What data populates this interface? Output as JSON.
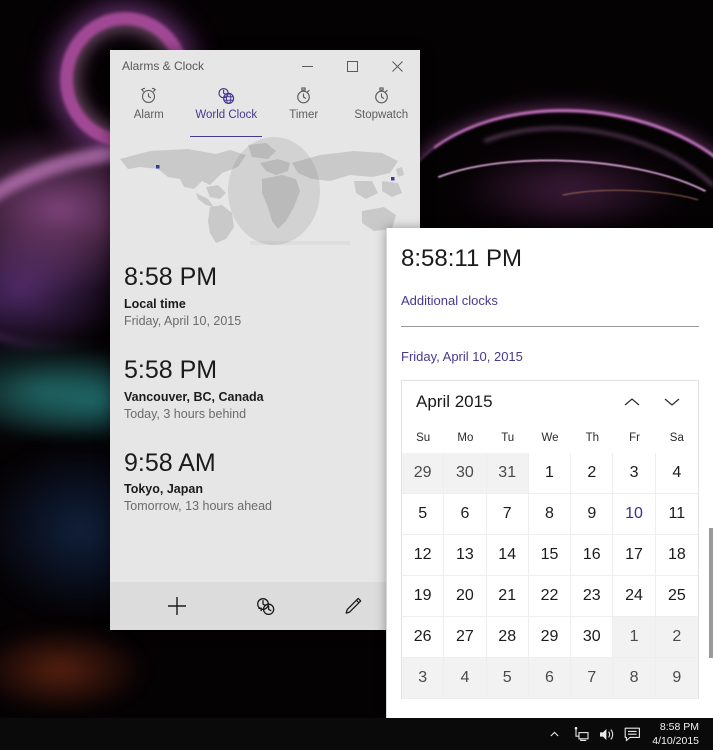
{
  "window": {
    "title": "Alarms & Clock",
    "controls": {
      "minimize": "—",
      "maximize": "☐",
      "close": "✕"
    }
  },
  "tabs": [
    {
      "label": "Alarm",
      "icon": "alarm-clock-icon",
      "active": false
    },
    {
      "label": "World Clock",
      "icon": "world-clock-globe-icon",
      "active": true
    },
    {
      "label": "Timer",
      "icon": "timer-icon",
      "active": false
    },
    {
      "label": "Stopwatch",
      "icon": "stopwatch-icon",
      "active": false
    }
  ],
  "clocks": [
    {
      "time": "8:58 PM",
      "place": "Local time",
      "sub": "Friday, April 10, 2015"
    },
    {
      "time": "5:58 PM",
      "place": "Vancouver, BC, Canada",
      "sub": "Today, 3 hours behind"
    },
    {
      "time": "9:58 AM",
      "place": "Tokyo, Japan",
      "sub": "Tomorrow, 13 hours ahead"
    }
  ],
  "commandbar": [
    {
      "name": "add-clock-button",
      "icon": "plus-icon"
    },
    {
      "name": "compare-clocks-button",
      "icon": "compare-clocks-icon"
    },
    {
      "name": "edit-clocks-button",
      "icon": "pencil-icon"
    }
  ],
  "flyout": {
    "time": "8:58:11 PM",
    "additional_clocks_link": "Additional clocks",
    "date_full": "Friday, April 10, 2015",
    "calendar": {
      "month_label": "April 2015",
      "prev_label": "⌃",
      "next_label": "⌄",
      "day_headers": [
        "Su",
        "Mo",
        "Tu",
        "We",
        "Th",
        "Fr",
        "Sa"
      ],
      "weeks": [
        [
          {
            "d": "29",
            "adjacent": true
          },
          {
            "d": "30",
            "adjacent": true
          },
          {
            "d": "31",
            "adjacent": true
          },
          {
            "d": "1",
            "adjacent": false
          },
          {
            "d": "2",
            "adjacent": false
          },
          {
            "d": "3",
            "adjacent": false
          },
          {
            "d": "4",
            "adjacent": false
          }
        ],
        [
          {
            "d": "5",
            "adjacent": false
          },
          {
            "d": "6",
            "adjacent": false
          },
          {
            "d": "7",
            "adjacent": false
          },
          {
            "d": "8",
            "adjacent": false
          },
          {
            "d": "9",
            "adjacent": false
          },
          {
            "d": "10",
            "adjacent": false,
            "today": true
          },
          {
            "d": "11",
            "adjacent": false
          }
        ],
        [
          {
            "d": "12",
            "adjacent": false
          },
          {
            "d": "13",
            "adjacent": false
          },
          {
            "d": "14",
            "adjacent": false
          },
          {
            "d": "15",
            "adjacent": false
          },
          {
            "d": "16",
            "adjacent": false
          },
          {
            "d": "17",
            "adjacent": false
          },
          {
            "d": "18",
            "adjacent": false
          }
        ],
        [
          {
            "d": "19",
            "adjacent": false
          },
          {
            "d": "20",
            "adjacent": false
          },
          {
            "d": "21",
            "adjacent": false
          },
          {
            "d": "22",
            "adjacent": false
          },
          {
            "d": "23",
            "adjacent": false
          },
          {
            "d": "24",
            "adjacent": false
          },
          {
            "d": "25",
            "adjacent": false
          }
        ],
        [
          {
            "d": "26",
            "adjacent": false
          },
          {
            "d": "27",
            "adjacent": false
          },
          {
            "d": "28",
            "adjacent": false
          },
          {
            "d": "29",
            "adjacent": false
          },
          {
            "d": "30",
            "adjacent": false
          },
          {
            "d": "1",
            "adjacent": true
          },
          {
            "d": "2",
            "adjacent": true
          }
        ],
        [
          {
            "d": "3",
            "adjacent": true
          },
          {
            "d": "4",
            "adjacent": true
          },
          {
            "d": "5",
            "adjacent": true
          },
          {
            "d": "6",
            "adjacent": true
          },
          {
            "d": "7",
            "adjacent": true
          },
          {
            "d": "8",
            "adjacent": true
          },
          {
            "d": "9",
            "adjacent": true
          }
        ]
      ]
    }
  },
  "taskbar": {
    "tray_icons": [
      {
        "name": "show-hidden-icons-chevron",
        "icon": "chevron-up-icon"
      },
      {
        "name": "network-icon",
        "icon": "network-icon"
      },
      {
        "name": "volume-icon",
        "icon": "speaker-icon"
      },
      {
        "name": "action-center-icon",
        "icon": "chat-bubble-icon"
      }
    ],
    "clock_time": "8:58 PM",
    "clock_date": "4/10/2015"
  },
  "colors": {
    "accent_purple": "#46398f",
    "today_purple": "#3b2e8f",
    "window_bg": "#e6e6e6",
    "flyout_bg": "#ffffff",
    "taskbar_bg": "#0a0a0a"
  }
}
